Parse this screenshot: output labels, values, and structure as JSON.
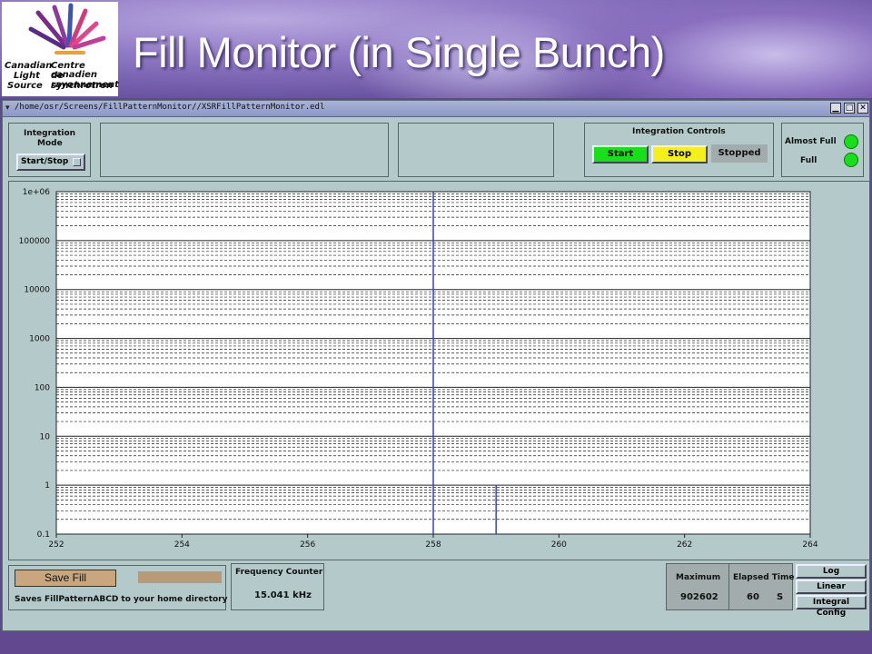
{
  "slide": {
    "title": "Fill Monitor (in Single Bunch)",
    "logo": {
      "line1_left": "Canadian",
      "line1_right": "Centre canadien",
      "line2_left": "Light",
      "line2_right": "de rayonnement",
      "line3_left": "Source",
      "line3_right": "synchrotron"
    }
  },
  "window": {
    "path": "/home/osr/Screens/FillPatternMonitor//XSRFillPatternMonitor.edl",
    "minimize_glyph": "▁",
    "maximize_glyph": "□",
    "close_glyph": "✕"
  },
  "integration_mode": {
    "title_line1": "Integration",
    "title_line2": "Mode",
    "toggle_label": "Start/Stop"
  },
  "integration_controls": {
    "title": "Integration Controls",
    "start_label": "Start",
    "stop_label": "Stop",
    "status": "Stopped"
  },
  "indicators": {
    "almost_full_label": "Almost Full",
    "full_label": "Full",
    "led_color": "#18e018"
  },
  "chart_data": {
    "type": "bar",
    "yscale": "log",
    "xlim": [
      252,
      264
    ],
    "ylim": [
      0.1,
      1000000
    ],
    "x_ticks": [
      "252",
      "254",
      "256",
      "258",
      "260",
      "262",
      "264"
    ],
    "y_ticks": [
      "0.1",
      "1",
      "10",
      "100",
      "1000",
      "10000",
      "100000",
      "1e+06"
    ],
    "grid": true,
    "series": [
      {
        "color": "#3344cc",
        "points": [
          {
            "x": 258,
            "y": 1000000
          },
          {
            "x": 259,
            "y": 1
          }
        ]
      }
    ]
  },
  "save": {
    "button_label": "Save Fill",
    "description": "Saves FillPatternABCD to your home directory",
    "status_color": "#b89a78"
  },
  "frequency": {
    "label": "Frequency Counter",
    "value": "15.041 kHz"
  },
  "stats": {
    "maximum_label": "Maximum",
    "maximum_value": "902602",
    "elapsed_label": "Elapsed Time",
    "elapsed_value": "60",
    "elapsed_unit": "S"
  },
  "scale_buttons": {
    "log": "Log",
    "linear": "Linear",
    "integral": "Integral Config"
  }
}
